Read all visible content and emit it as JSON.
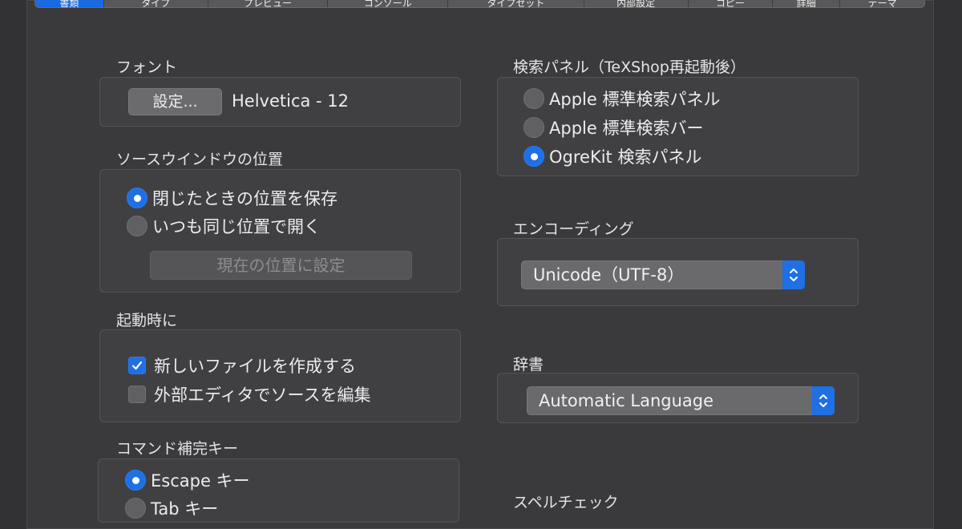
{
  "tabs": [
    {
      "label": "書類",
      "active": true
    },
    {
      "label": "タイプ",
      "active": false
    },
    {
      "label": "プレビュー",
      "active": false
    },
    {
      "label": "コンソール",
      "active": false
    },
    {
      "label": "タイプセット",
      "active": false
    },
    {
      "label": "内部設定",
      "active": false
    },
    {
      "label": "コピー",
      "active": false
    },
    {
      "label": "詳細",
      "active": false
    },
    {
      "label": "テーマ",
      "active": false
    }
  ],
  "font": {
    "label": "フォント",
    "button": "設定...",
    "value": "Helvetica - 12"
  },
  "source_window": {
    "label": "ソースウインドウの位置",
    "options": [
      {
        "label": "閉じたときの位置を保存",
        "selected": true
      },
      {
        "label": "いつも同じ位置で開く",
        "selected": false
      }
    ],
    "set_current_button": "現在の位置に設定"
  },
  "startup": {
    "label": "起動時に",
    "options": [
      {
        "label": "新しいファイルを作成する",
        "checked": true
      },
      {
        "label": "外部エディタでソースを編集",
        "checked": false
      }
    ]
  },
  "command_completion": {
    "label": "コマンド補完キー",
    "options": [
      {
        "label": "Escape キー",
        "selected": true
      },
      {
        "label": "Tab キー",
        "selected": false
      }
    ]
  },
  "search_panel": {
    "label": "検索パネル（TeXShop再起動後）",
    "options": [
      {
        "label": "Apple 標準検索パネル",
        "selected": false
      },
      {
        "label": "Apple 標準検索バー",
        "selected": false
      },
      {
        "label": "OgreKit 検索パネル",
        "selected": true
      }
    ]
  },
  "encoding": {
    "label": "エンコーディング",
    "value": "Unicode（UTF-8）"
  },
  "dictionary": {
    "label": "辞書",
    "value": "Automatic Language"
  },
  "spellcheck": {
    "label": "スペルチェック"
  },
  "colors": {
    "accent": "#1f6fe5",
    "background": "#3a3a3c",
    "group_box": "#404042"
  }
}
